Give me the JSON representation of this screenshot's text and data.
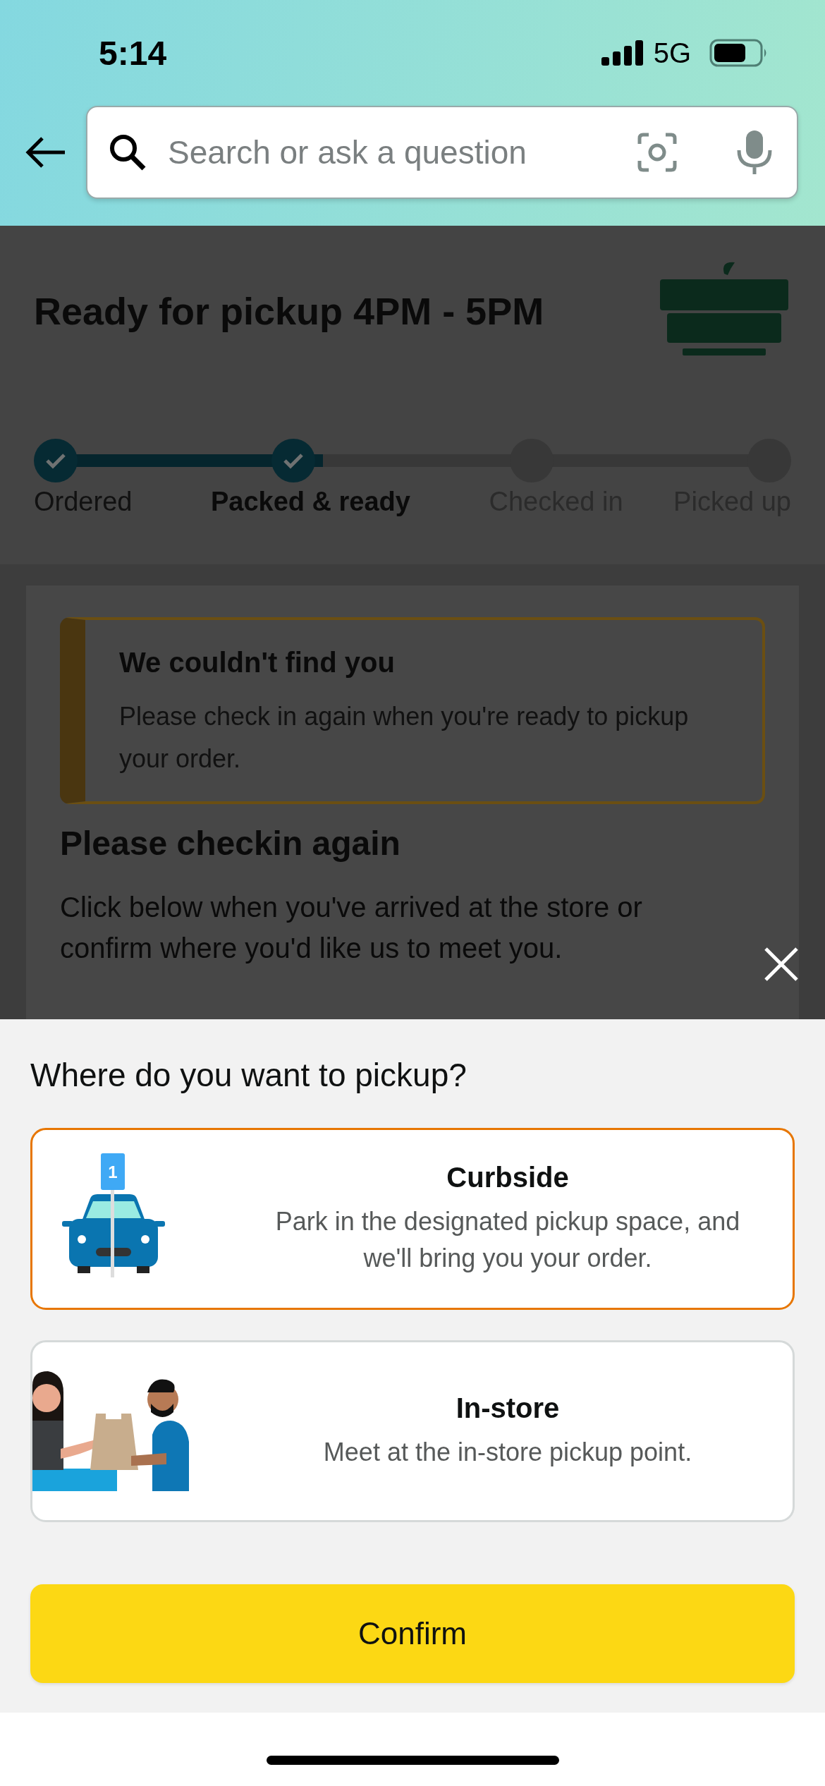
{
  "status_bar": {
    "time": "5:14",
    "network": "5G"
  },
  "search": {
    "placeholder": "Search or ask a question"
  },
  "header": {
    "title": "Ready for pickup 4PM - 5PM"
  },
  "progress": {
    "level": 0.375,
    "steps": [
      {
        "label": "Ordered",
        "completed": true,
        "current": false
      },
      {
        "label": "Packed & ready",
        "completed": true,
        "current": true
      },
      {
        "label": "Checked in",
        "completed": false,
        "current": false
      },
      {
        "label": "Picked up",
        "completed": false,
        "current": false
      }
    ]
  },
  "alert": {
    "title": "We couldn't find you",
    "message": "Please check in again when you're ready to pickup your order."
  },
  "checkin": {
    "heading": "Please checkin again",
    "text": "Click below when you've arrived at the store or confirm where you'd like us to meet you."
  },
  "sheet": {
    "title": "Where do you want to pickup?",
    "options": [
      {
        "kind": "curbside",
        "title": "Curbside",
        "description": "Park in the designated pickup space, and we'll bring you your order.",
        "badge": "1",
        "selected": true
      },
      {
        "kind": "instore",
        "title": "In-store",
        "description": "Meet at the in-store pickup point.",
        "selected": false
      }
    ],
    "button": "Confirm"
  }
}
